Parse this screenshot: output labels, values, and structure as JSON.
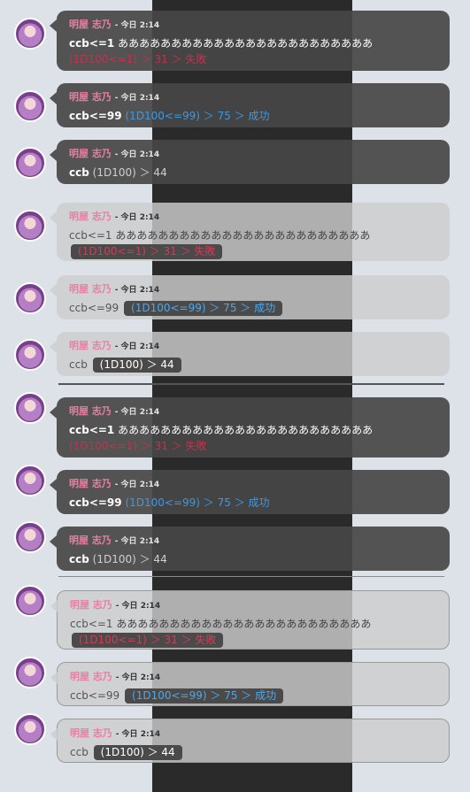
{
  "author": "明屋 志乃",
  "time": "- 今日 2:14",
  "messages": [
    {
      "cmd": "ccb<=1",
      "text": "ああああああああああああああああああああああああ",
      "result": "(1D100<=1) ＞ 31 ＞ 失敗",
      "result_type": "fail"
    },
    {
      "cmd": "ccb<=99",
      "text": "",
      "result": "(1D100<=99) ＞ 75 ＞ 成功",
      "result_type": "ok"
    },
    {
      "cmd": "ccb",
      "text": "",
      "result": "(1D100) ＞ 44",
      "result_type": "plain"
    }
  ],
  "colors": {
    "background": "#dde2e9",
    "stripe": "#2a2a2a",
    "name": "#e87fa2",
    "fail": "#c0334f",
    "success": "#3a9ae6"
  },
  "icons": {
    "avatar": "character-avatar"
  }
}
